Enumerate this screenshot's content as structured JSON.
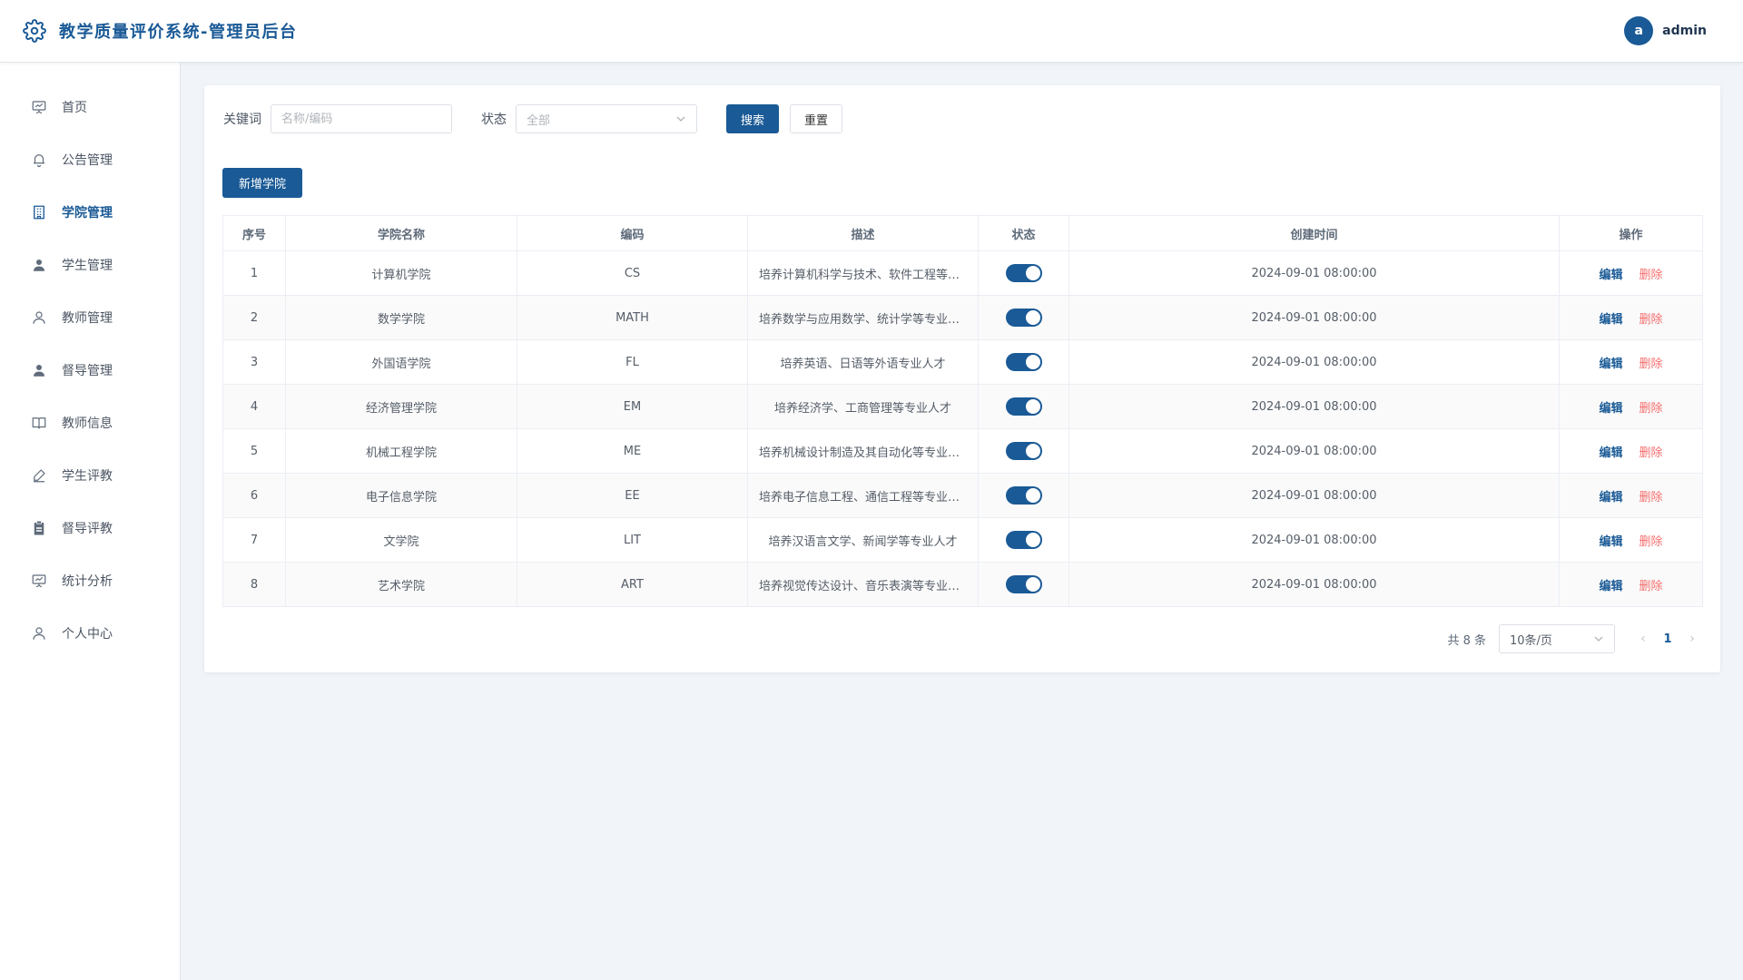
{
  "header": {
    "title": "教学质量评价系统-管理员后台",
    "avatar_letter": "a",
    "username": "admin"
  },
  "sidebar": {
    "items": [
      {
        "label": "首页",
        "icon": "presentation-board-icon"
      },
      {
        "label": "公告管理",
        "icon": "bell-icon"
      },
      {
        "label": "学院管理",
        "icon": "building-icon",
        "active": true
      },
      {
        "label": "学生管理",
        "icon": "user-filled-icon"
      },
      {
        "label": "教师管理",
        "icon": "user-outline-icon"
      },
      {
        "label": "督导管理",
        "icon": "user-filled-icon"
      },
      {
        "label": "教师信息",
        "icon": "book-icon"
      },
      {
        "label": "学生评教",
        "icon": "edit-pen-icon"
      },
      {
        "label": "督导评教",
        "icon": "clipboard-icon"
      },
      {
        "label": "统计分析",
        "icon": "chart-board-icon"
      },
      {
        "label": "个人中心",
        "icon": "user-outline-icon"
      }
    ]
  },
  "filter": {
    "keyword_label": "关键词",
    "keyword_placeholder": "名称/编码",
    "status_label": "状态",
    "status_value": "全部",
    "search_label": "搜索",
    "reset_label": "重置"
  },
  "add_button": "新增学院",
  "table": {
    "columns": [
      "序号",
      "学院名称",
      "编码",
      "描述",
      "状态",
      "创建时间",
      "操作"
    ],
    "rows": [
      {
        "index": "1",
        "name": "计算机学院",
        "code": "CS",
        "desc": "培养计算机科学与技术、软件工程等专业人才",
        "status_on": true,
        "created": "2024-09-01 08:00:00"
      },
      {
        "index": "2",
        "name": "数学学院",
        "code": "MATH",
        "desc": "培养数学与应用数学、统计学等专业人才",
        "status_on": true,
        "created": "2024-09-01 08:00:00"
      },
      {
        "index": "3",
        "name": "外国语学院",
        "code": "FL",
        "desc": "培养英语、日语等外语专业人才",
        "status_on": true,
        "created": "2024-09-01 08:00:00"
      },
      {
        "index": "4",
        "name": "经济管理学院",
        "code": "EM",
        "desc": "培养经济学、工商管理等专业人才",
        "status_on": true,
        "created": "2024-09-01 08:00:00"
      },
      {
        "index": "5",
        "name": "机械工程学院",
        "code": "ME",
        "desc": "培养机械设计制造及其自动化等专业人才",
        "status_on": true,
        "created": "2024-09-01 08:00:00"
      },
      {
        "index": "6",
        "name": "电子信息学院",
        "code": "EE",
        "desc": "培养电子信息工程、通信工程等专业人才",
        "status_on": true,
        "created": "2024-09-01 08:00:00"
      },
      {
        "index": "7",
        "name": "文学院",
        "code": "LIT",
        "desc": "培养汉语言文学、新闻学等专业人才",
        "status_on": true,
        "created": "2024-09-01 08:00:00"
      },
      {
        "index": "8",
        "name": "艺术学院",
        "code": "ART",
        "desc": "培养视觉传达设计、音乐表演等专业人才",
        "status_on": true,
        "created": "2024-09-01 08:00:00"
      }
    ],
    "edit_label": "编辑",
    "delete_label": "删除"
  },
  "pagination": {
    "total_text": "共 8 条",
    "page_size": "10条/页",
    "current_page": "1"
  },
  "colors": {
    "primary": "#1a5a96",
    "danger": "#f56c6c",
    "background": "#f1f4f8"
  }
}
